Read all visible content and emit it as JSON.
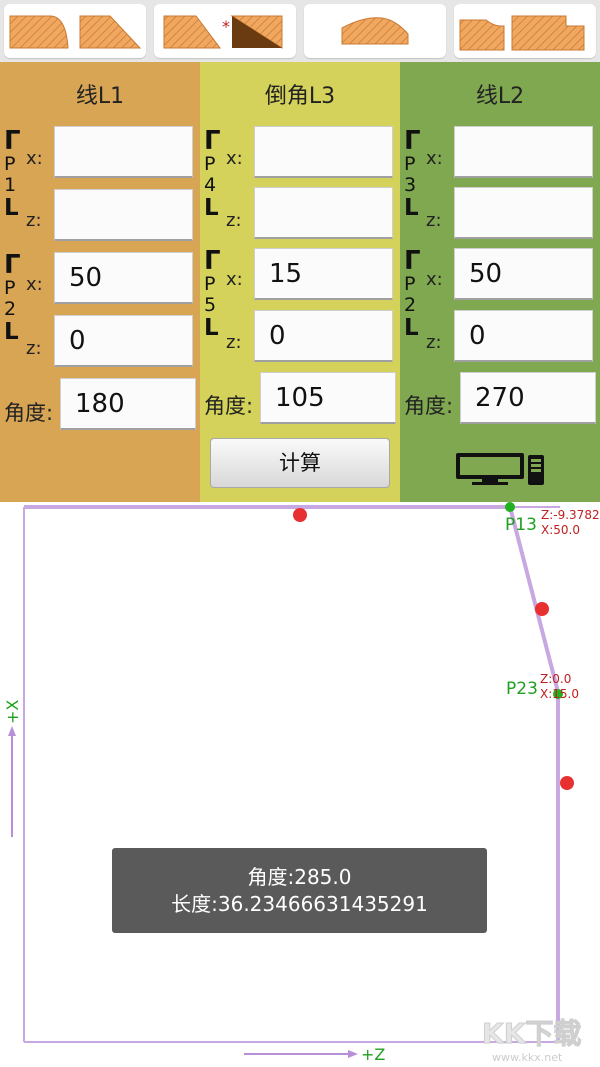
{
  "toolbar": {
    "buttons": [
      {
        "name": "profile-option-1",
        "icon": "profile-shapes-icon"
      },
      {
        "name": "profile-option-2",
        "icon": "chamfer-profile-icon",
        "marker": "*"
      },
      {
        "name": "profile-option-3",
        "icon": "arc-profile-icon"
      },
      {
        "name": "profile-option-4",
        "icon": "step-profile-icon"
      }
    ]
  },
  "panels": {
    "line1": {
      "title": "线L1",
      "top_bracket": [
        "P",
        "1"
      ],
      "bottom_bracket": [
        "P",
        "2"
      ],
      "x1": "",
      "z1": "",
      "x2": "50",
      "z2": "0",
      "angle": "180"
    },
    "chamfer": {
      "title": "倒角L3",
      "top_bracket": [
        "P",
        "4"
      ],
      "bottom_bracket": [
        "P",
        "5"
      ],
      "x1": "",
      "z1": "",
      "x2": "15",
      "z2": "0",
      "angle": "105"
    },
    "line2": {
      "title": "线L2",
      "top_bracket": [
        "P",
        "3"
      ],
      "bottom_bracket": [
        "P",
        "2"
      ],
      "x1": "",
      "z1": "",
      "x2": "50",
      "z2": "0",
      "angle": "270"
    }
  },
  "labels": {
    "x": "x:",
    "z": "z:",
    "angle": "角度:",
    "bracket_top": "Γ",
    "bracket_bottom": "L"
  },
  "calc_button": "计算",
  "display_icon": "computer-display-icon",
  "canvas": {
    "p13_label": "P13",
    "p13_z": "Z:-9.3782",
    "p13_x": "X:50.0",
    "p23_label": "P23",
    "p23_z": "Z:0.0",
    "p23_x": "X:15.0",
    "x_axis_label": "+X",
    "z_axis_label": "+Z"
  },
  "toast": {
    "angle": "角度:285.0",
    "length": "长度:36.23466631435291"
  },
  "watermark": {
    "logo": "KK下载",
    "site": "www.kkx.net"
  },
  "colors": {
    "line1_bg": "#d8a555",
    "chamfer_bg": "#d4d25a",
    "line2_bg": "#80a850",
    "profile_line": "#c7a8e0",
    "point_red": "#e83030",
    "point_green": "#20b020",
    "label_red": "#c02020",
    "label_green": "#20a020"
  }
}
